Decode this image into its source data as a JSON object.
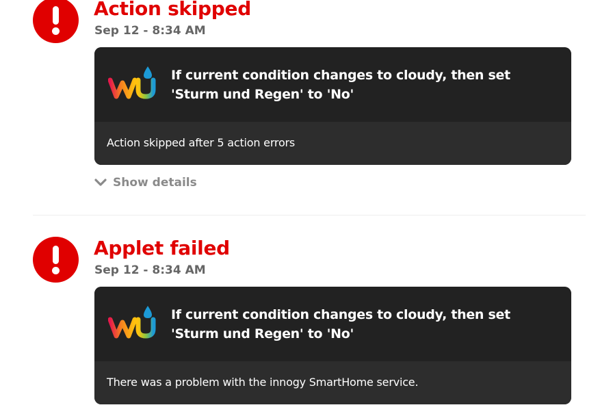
{
  "events": [
    {
      "title": "Action skipped",
      "time": "Sep 12 - 8:34 AM",
      "card": {
        "service_icon": "weather-underground-logo",
        "applet_title": "If current condition changes to cloudy, then set 'Sturm und Regen' to 'No'",
        "message": "Action skipped after 5 action errors"
      },
      "details_label": "Show details"
    },
    {
      "title": "Applet failed",
      "time": "Sep 12 - 8:34 AM",
      "card": {
        "service_icon": "weather-underground-logo",
        "applet_title": "If current condition changes to cloudy, then set 'Sturm und Regen' to 'No'",
        "message": "There was a problem with the innogy SmartHome service."
      }
    }
  ],
  "colors": {
    "error": "#e00000",
    "card_bg": "#222222",
    "card_footer_bg": "#2d2d2d",
    "muted_text": "#666666",
    "details_text": "#8a8a8a"
  },
  "icons": {
    "alert": "alert-icon",
    "chevron": "chevron-down-icon"
  }
}
